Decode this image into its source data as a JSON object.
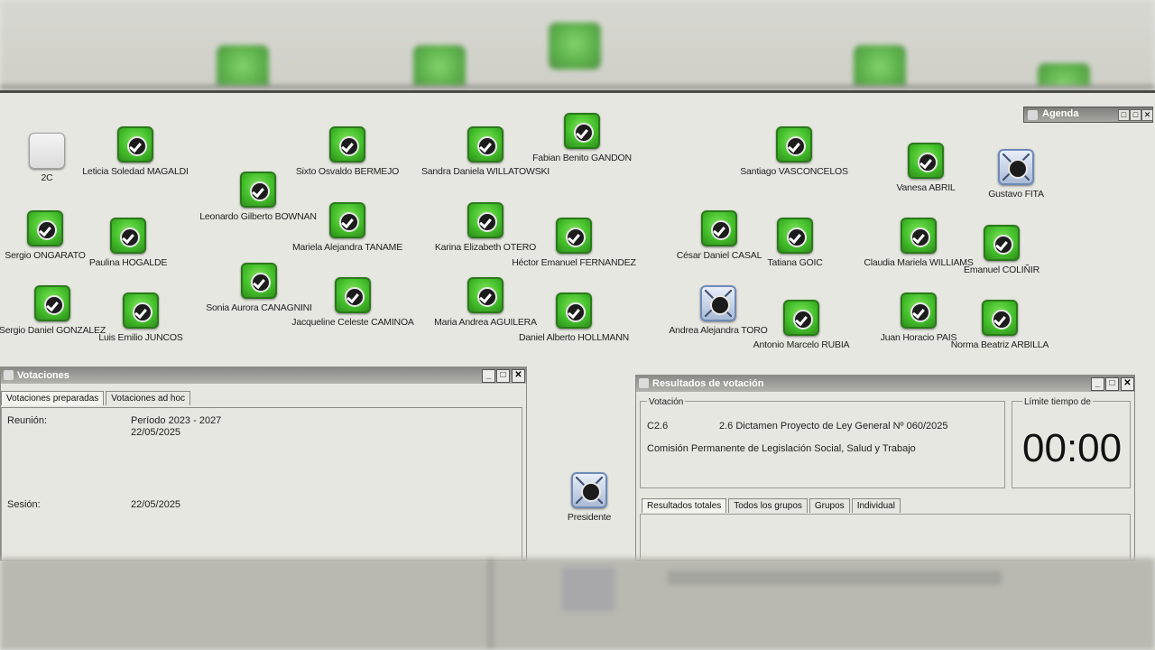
{
  "agenda": {
    "title": "Agenda"
  },
  "delegates": [
    {
      "id": "d0",
      "label": "2C",
      "style": "grey"
    },
    {
      "id": "d1",
      "label": "Leticia Soledad MAGALDI",
      "style": "green"
    },
    {
      "id": "d2",
      "label": "Leonardo Gilberto BOWNAN",
      "style": "green"
    },
    {
      "id": "d3",
      "label": "Sixto Osvaldo BERMEJO",
      "style": "green"
    },
    {
      "id": "d4",
      "label": "Sandra Daniela WILLATOWSKI",
      "style": "green"
    },
    {
      "id": "d5",
      "label": "Fabian Benito GANDON",
      "style": "green"
    },
    {
      "id": "d6",
      "label": "Santiago VASCONCELOS",
      "style": "green"
    },
    {
      "id": "d7",
      "label": "Vanesa ABRIL",
      "style": "green"
    },
    {
      "id": "d8",
      "label": "Gustavo FITA",
      "style": "blue"
    },
    {
      "id": "d9",
      "label": "Sergio ONGARATO",
      "style": "green"
    },
    {
      "id": "d10",
      "label": "Paulina HOGALDE",
      "style": "green"
    },
    {
      "id": "d11",
      "label": "Mariela Alejandra TANAME",
      "style": "green"
    },
    {
      "id": "d12",
      "label": "Karina Elizabeth OTERO",
      "style": "green"
    },
    {
      "id": "d13",
      "label": "Héctor Emanuel FERNANDEZ",
      "style": "green"
    },
    {
      "id": "d14",
      "label": "César Daniel CASAL",
      "style": "green"
    },
    {
      "id": "d15",
      "label": "Tatiana GOIC",
      "style": "green"
    },
    {
      "id": "d16",
      "label": "Claudia Mariela WILLIAMS",
      "style": "green"
    },
    {
      "id": "d17",
      "label": "Emanuel COLIÑIR",
      "style": "green"
    },
    {
      "id": "d18",
      "label": "Sergio Daniel GONZALEZ",
      "style": "green"
    },
    {
      "id": "d19",
      "label": "Luis Emilio JUNCOS",
      "style": "green"
    },
    {
      "id": "d20",
      "label": "Sonia Aurora CANAGNINI",
      "style": "green"
    },
    {
      "id": "d21",
      "label": "Jacqueline Celeste CAMINOA",
      "style": "green"
    },
    {
      "id": "d22",
      "label": "Maria Andrea AGUILERA",
      "style": "green"
    },
    {
      "id": "d23",
      "label": "Daniel Alberto HOLLMANN",
      "style": "green"
    },
    {
      "id": "d24",
      "label": "Andrea Alejandra TORO",
      "style": "blue"
    },
    {
      "id": "d25",
      "label": "Antonio Marcelo RUBIA",
      "style": "green"
    },
    {
      "id": "d26",
      "label": "Juan Horacio PAIS",
      "style": "green"
    },
    {
      "id": "d27",
      "label": "Norma Beatriz ARBILLA",
      "style": "green"
    },
    {
      "id": "d28",
      "label": "Presidente",
      "style": "blue"
    }
  ],
  "votaciones": {
    "title": "Votaciones",
    "tabs": [
      "Votaciones preparadas",
      "Votaciones ad hoc"
    ],
    "reunion_label": "Reunión:",
    "reunion_value1": "Período 2023 - 2027",
    "reunion_value2": "22/05/2025",
    "sesion_label": "Sesión:",
    "sesion_value": "22/05/2025"
  },
  "resultados": {
    "title": "Resultados de votación",
    "votacion_label": "Votación",
    "code": "C2.6",
    "description": "2.6 Dictamen Proyecto de Ley General Nº 060/2025",
    "commission": "Comisión Permanente de Legislación Social, Salud y Trabajo",
    "limit_label": "Límite tiempo de",
    "timer": "00:00",
    "tabs": [
      "Resultados totales",
      "Todos los grupos",
      "Grupos",
      "Individual"
    ]
  },
  "window_controls": {
    "minimize": "_",
    "maximize": "□",
    "close": "✕"
  },
  "colors": {
    "accent_green": "#44c02b",
    "titlebar": "#8a8a86",
    "background": "#e7e7e1"
  }
}
